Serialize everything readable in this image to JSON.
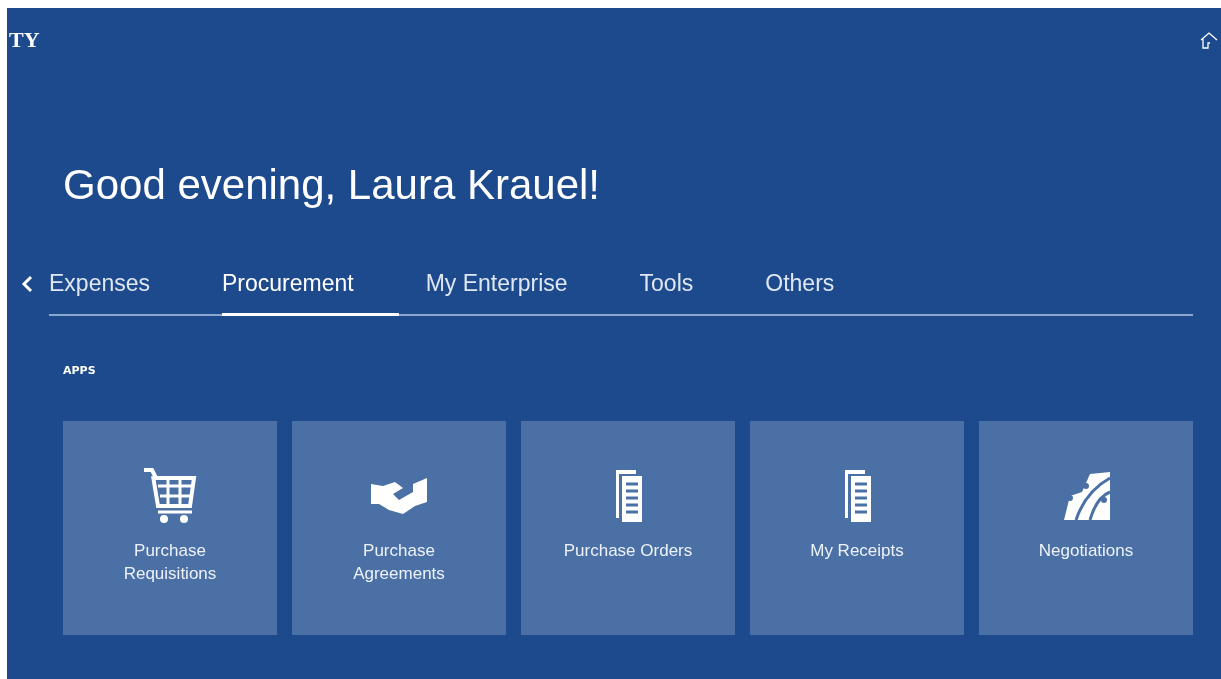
{
  "header": {
    "logo": "TY"
  },
  "greeting": "Good evening, Laura Krauel!",
  "tabs": [
    {
      "label": "Expenses",
      "selected": false
    },
    {
      "label": "Procurement",
      "selected": true
    },
    {
      "label": "My Enterprise",
      "selected": false
    },
    {
      "label": "Tools",
      "selected": false
    },
    {
      "label": "Others",
      "selected": false
    }
  ],
  "section_label": "APPS",
  "apps": [
    {
      "label": "Purchase Requisitions",
      "kind": "cart"
    },
    {
      "label": "Purchase Agreements",
      "kind": "handshake"
    },
    {
      "label": "Purchase Orders",
      "kind": "documents"
    },
    {
      "label": "My Receipts",
      "kind": "documents"
    },
    {
      "label": "Negotiations",
      "kind": "map"
    }
  ]
}
